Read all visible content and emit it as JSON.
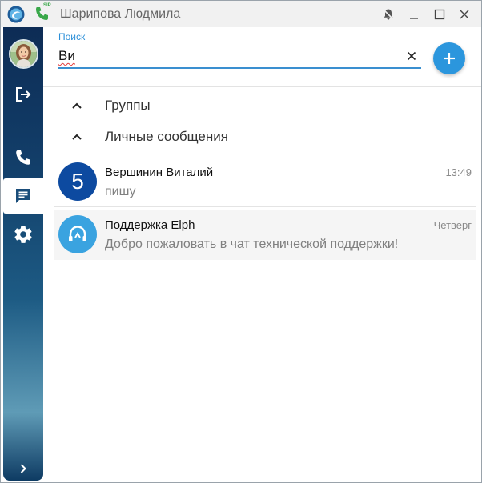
{
  "window": {
    "title": "Шарипова Людмила",
    "sip_badge": "SIP"
  },
  "sidebar": {
    "items": [
      {
        "name": "logout",
        "icon": "logout-icon"
      },
      {
        "name": "calls",
        "icon": "phone-icon"
      },
      {
        "name": "chats",
        "icon": "chat-icon",
        "active": true
      },
      {
        "name": "settings",
        "icon": "gear-icon"
      },
      {
        "name": "expand",
        "icon": "chevron-right-icon"
      }
    ]
  },
  "search": {
    "label": "Поиск",
    "value": "Ви"
  },
  "sections": [
    {
      "label": "Группы",
      "expanded": true
    },
    {
      "label": "Личные сообщения",
      "expanded": true
    }
  ],
  "chats": [
    {
      "avatar_text": "5",
      "name": "Вершинин Виталий",
      "message": "пишу",
      "time": "13:49"
    },
    {
      "avatar_icon": "headset-icon",
      "name": "Поддержка Elph",
      "message": "Добро пожаловать в чат технической поддержки!",
      "time": "Четверг"
    }
  ],
  "colors": {
    "accent": "#2b96dd",
    "sidebar_top": "#0d2c55",
    "unread_avatar": "#0d4aa0",
    "search_underline": "#3a8fd0",
    "sip_green": "#3aa84a"
  }
}
